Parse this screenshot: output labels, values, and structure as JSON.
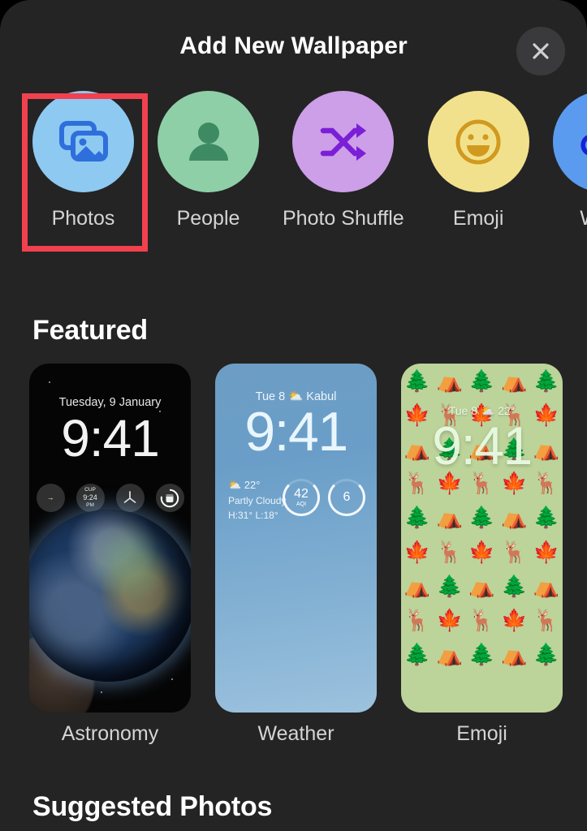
{
  "header": {
    "title": "Add New Wallpaper",
    "close_icon": "close-icon"
  },
  "categories": [
    {
      "label": "Photos",
      "icon": "photos-stack-icon",
      "circle_color": "#8EC9F2",
      "glyph_color": "#2F6FDB",
      "selected": true
    },
    {
      "label": "People",
      "icon": "person-icon",
      "circle_color": "#8ECFA8",
      "glyph_color": "#3E8B63",
      "selected": false
    },
    {
      "label": "Photo Shuffle",
      "icon": "shuffle-icon",
      "circle_color": "#CC9FE8",
      "glyph_color": "#7A1FD6",
      "selected": false
    },
    {
      "label": "Emoji",
      "icon": "smiley-icon",
      "circle_color": "#F2E18C",
      "glyph_color": "#D19A1E",
      "selected": false
    },
    {
      "label": "Weat",
      "icon": "cloud-sun-icon",
      "circle_color": "#5B9BEF",
      "glyph_color": "#1422D8",
      "selected": false
    }
  ],
  "highlight": {
    "color": "#F2414E"
  },
  "featured": {
    "title": "Featured",
    "cards": [
      {
        "label": "Astronomy",
        "date": "Tuesday, 9 January",
        "time": "9:41",
        "widgets": [
          {
            "name": "arrow-widget",
            "top": "",
            "mid": "→",
            "bot": ""
          },
          {
            "name": "weather-widget",
            "top": "CUP",
            "mid": "9:24",
            "bot": "PM"
          },
          {
            "name": "clock-widget",
            "top": "",
            "mid": "",
            "bot": ""
          },
          {
            "name": "battery-widget",
            "top": "",
            "mid": "",
            "bot": ""
          }
        ]
      },
      {
        "label": "Weather",
        "top_line": "Tue 8  ⛅  Kabul",
        "time": "9:41",
        "temp": "⛅ 22°",
        "condition": "Partly Cloudy",
        "high_low": "H:31° L:18°",
        "gauges": [
          {
            "value": "42",
            "label": "AQI"
          },
          {
            "value": "6",
            "label": ""
          }
        ]
      },
      {
        "label": "Emoji",
        "top_line": "Tue 8 ⛅ 22°",
        "time": "9:41",
        "pattern": [
          "🌲",
          "⛺",
          "🌲",
          "⛺",
          "🌲",
          "🍁",
          "🦌",
          "🍁",
          "🦌",
          "🍁",
          "⛺",
          "🌲",
          "⛺",
          "🌲",
          "⛺",
          "🦌",
          "🍁",
          "🦌",
          "🍁",
          "🦌",
          "🌲",
          "⛺",
          "🌲",
          "⛺",
          "🌲",
          "🍁",
          "🦌",
          "🍁",
          "🦌",
          "🍁",
          "⛺",
          "🌲",
          "⛺",
          "🌲",
          "⛺",
          "🦌",
          "🍁",
          "🦌",
          "🍁",
          "🦌",
          "🌲",
          "⛺",
          "🌲",
          "⛺",
          "🌲"
        ]
      }
    ]
  },
  "suggested": {
    "title": "Suggested Photos"
  }
}
